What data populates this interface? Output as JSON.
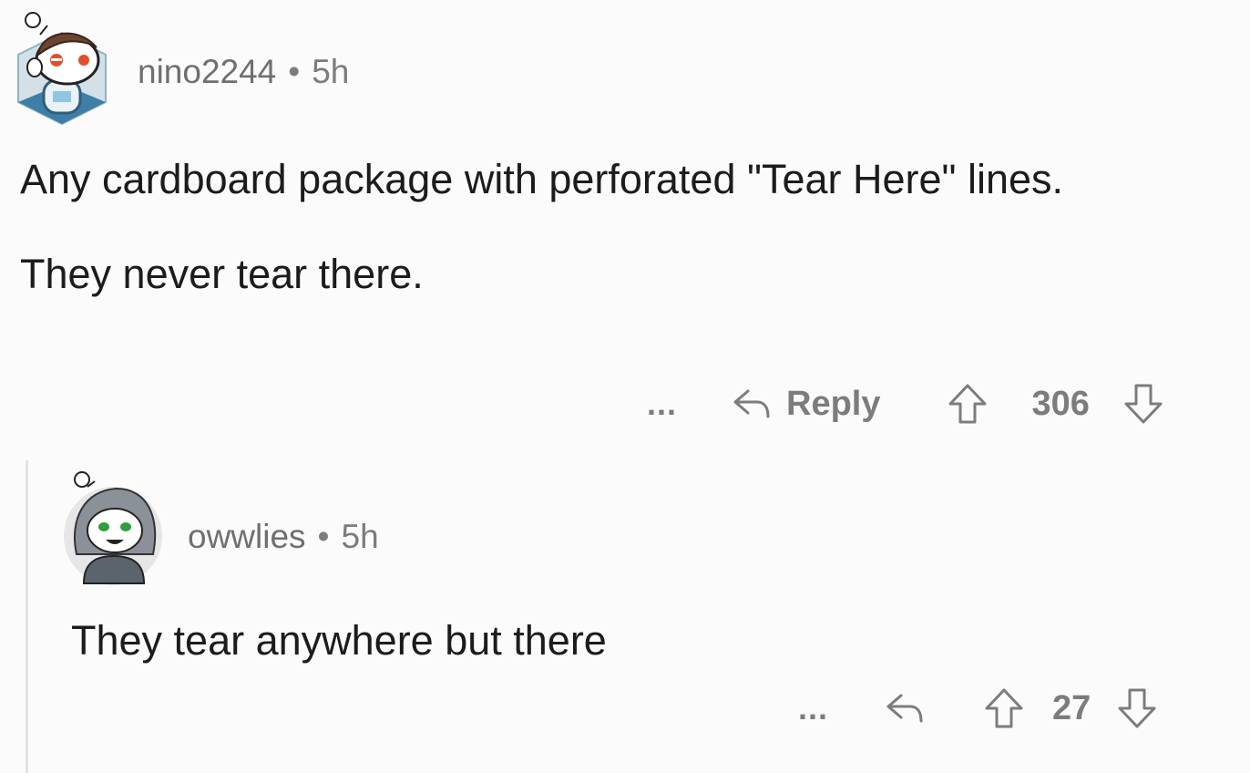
{
  "comments": [
    {
      "username": "nino2244",
      "age": "5h",
      "body": [
        "Any cardboard package with perforated \"Tear Here\" lines.",
        "They never tear there."
      ],
      "reply_label": "Reply",
      "more_label": "...",
      "score": "306"
    },
    {
      "username": "owwlies",
      "age": "5h",
      "body": [
        "They tear anywhere but there"
      ],
      "more_label": "...",
      "score": "27"
    }
  ],
  "separator": "•",
  "icons": {
    "reply": "reply-arrow-icon",
    "upvote": "upvote-arrow-icon",
    "downvote": "downvote-arrow-icon",
    "more": "ellipsis-icon"
  },
  "colors": {
    "background": "#fbfbfb",
    "text": "#1c1c1c",
    "meta": "#7c7c7c",
    "thread_line": "#e3e3e3"
  }
}
